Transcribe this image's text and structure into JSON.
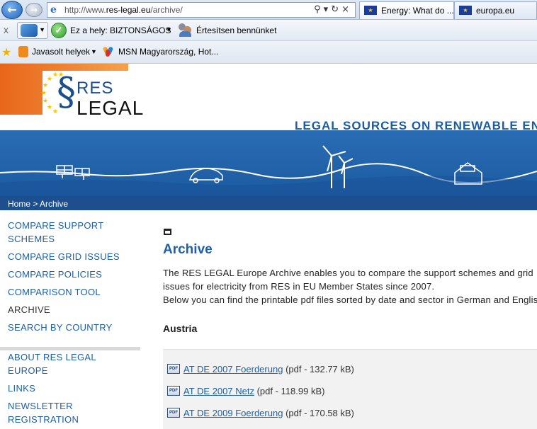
{
  "browser": {
    "url_prefix": "http://www.",
    "url_domain": "res-legal.eu",
    "url_path": "/archive/",
    "tabs": [
      {
        "label": "Energy: What do ..."
      },
      {
        "label": "europa.eu"
      }
    ],
    "command_bar": {
      "close_glyph": "x",
      "safety_text": "Ez a hely: BIZTONSÁGOS",
      "notify_text": "Értesítsen bennünket"
    },
    "favorites_bar": {
      "suggested": "Javasolt helyek",
      "msn": "MSN Magyarország, Hot..."
    }
  },
  "site": {
    "logo_res": "RES",
    "logo_legal": "LEGAL",
    "logo_s": "§",
    "tagline": "LEGAL SOURCES ON RENEWABLE ENERGY",
    "breadcrumb": {
      "home": "Home",
      "separator": " > ",
      "current": "Archive"
    },
    "sidebar": {
      "items": [
        {
          "label": "COMPARE SUPPORT SCHEMES"
        },
        {
          "label": "COMPARE GRID ISSUES"
        },
        {
          "label": "COMPARE POLICIES"
        },
        {
          "label": "COMPARISON TOOL"
        },
        {
          "label": "ARCHIVE"
        },
        {
          "label": "SEARCH BY COUNTRY"
        },
        {
          "label": "ABOUT RES LEGAL EUROPE"
        },
        {
          "label": "LINKS"
        },
        {
          "label": "NEWSLETTER REGISTRATION"
        }
      ]
    },
    "main": {
      "heading": "Archive",
      "intro_line1": "The RES LEGAL Europe Archive enables you to compare the support schemes and grid",
      "intro_line2": "issues for electricity from RES in EU Member States since 2007.",
      "intro_line3": "Below you can find the printable pdf files sorted by date and sector in German and English.",
      "country": "Austria",
      "pdf_badge": "PDF",
      "files": [
        {
          "name": "AT DE 2007 Foerderung",
          "meta": "(pdf - 132.77 kB)"
        },
        {
          "name": "AT DE 2007 Netz",
          "meta": "(pdf - 118.99 kB)"
        },
        {
          "name": "AT DE 2009 Foerderung",
          "meta": "(pdf - 170.58 kB)"
        }
      ]
    }
  },
  "colors": {
    "link_blue": "#1d5fa8",
    "banner_blue": "#1f5fa6",
    "breadcrumb_bar": "#1d4f8f",
    "header_orange": "#e8661a"
  },
  "icons": {
    "back": "back-arrow-icon",
    "forward": "forward-arrow-icon",
    "safe": "checkmark-shield-icon",
    "print": "printer-icon",
    "pdf": "pdf-file-icon"
  }
}
